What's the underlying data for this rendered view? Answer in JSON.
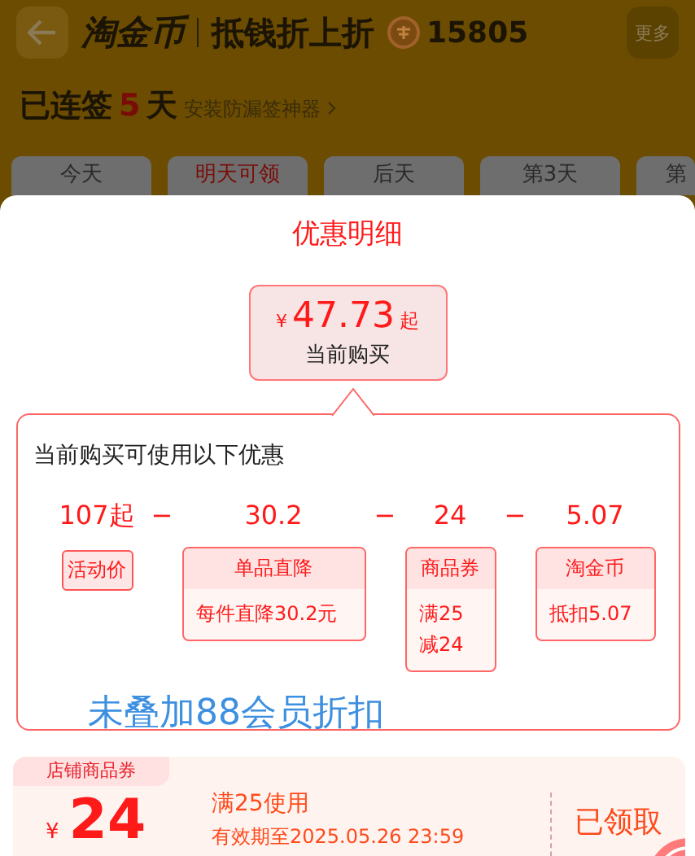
{
  "header": {
    "brand": "淘金币",
    "subtitle": "抵钱折上折",
    "coin_count": "15805",
    "more": "更多"
  },
  "streak": {
    "prefix": "已连签",
    "days": "5",
    "suffix": "天",
    "link": "安装防漏签神器"
  },
  "day_tabs": [
    {
      "label": "今天",
      "selected": false
    },
    {
      "label": "明天可领",
      "selected": true
    },
    {
      "label": "后天",
      "selected": false
    },
    {
      "label": "第3天",
      "selected": false
    },
    {
      "label": "第",
      "selected": false
    }
  ],
  "sheet": {
    "title": "优惠明细",
    "price": {
      "currency": "¥",
      "amount": "47.73",
      "suffix": "起",
      "caption": "当前购买"
    },
    "panel": {
      "title": "当前购买可使用以下优惠",
      "items": [
        {
          "kind": "tag",
          "value": "107起",
          "label": "活动价"
        },
        {
          "kind": "minus",
          "value": "−"
        },
        {
          "kind": "card",
          "value": "30.2",
          "label": "单品直降",
          "detail": "每件直降30.2元"
        },
        {
          "kind": "minus",
          "value": "−"
        },
        {
          "kind": "card",
          "value": "24",
          "label": "商品券",
          "detail": "满25减24"
        },
        {
          "kind": "minus",
          "value": "−"
        },
        {
          "kind": "card",
          "value": "5.07",
          "label": "淘金币",
          "detail": "抵扣5.07"
        }
      ]
    },
    "note": "未叠加88会员折扣",
    "coupon": {
      "tag": "店铺商品券",
      "currency": "¥",
      "amount": "24",
      "condition": "满25使用",
      "validity": "有效期至2025.05.26 23:59",
      "status": "已领取"
    }
  }
}
